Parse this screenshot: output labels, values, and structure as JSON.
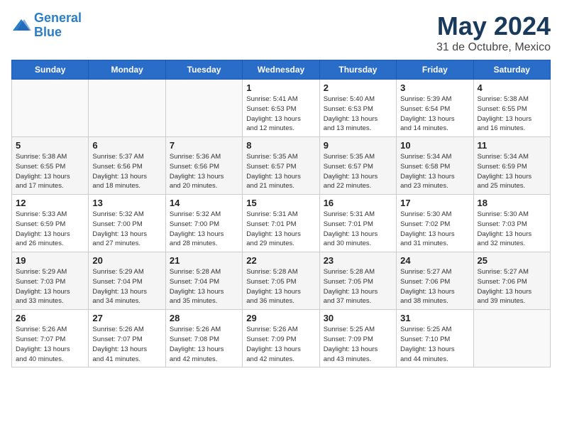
{
  "logo": {
    "line1": "General",
    "line2": "Blue"
  },
  "title": "May 2024",
  "subtitle": "31 de Octubre, Mexico",
  "days_header": [
    "Sunday",
    "Monday",
    "Tuesday",
    "Wednesday",
    "Thursday",
    "Friday",
    "Saturday"
  ],
  "weeks": [
    [
      {
        "num": "",
        "info": ""
      },
      {
        "num": "",
        "info": ""
      },
      {
        "num": "",
        "info": ""
      },
      {
        "num": "1",
        "info": "Sunrise: 5:41 AM\nSunset: 6:53 PM\nDaylight: 13 hours\nand 12 minutes."
      },
      {
        "num": "2",
        "info": "Sunrise: 5:40 AM\nSunset: 6:53 PM\nDaylight: 13 hours\nand 13 minutes."
      },
      {
        "num": "3",
        "info": "Sunrise: 5:39 AM\nSunset: 6:54 PM\nDaylight: 13 hours\nand 14 minutes."
      },
      {
        "num": "4",
        "info": "Sunrise: 5:38 AM\nSunset: 6:55 PM\nDaylight: 13 hours\nand 16 minutes."
      }
    ],
    [
      {
        "num": "5",
        "info": "Sunrise: 5:38 AM\nSunset: 6:55 PM\nDaylight: 13 hours\nand 17 minutes."
      },
      {
        "num": "6",
        "info": "Sunrise: 5:37 AM\nSunset: 6:56 PM\nDaylight: 13 hours\nand 18 minutes."
      },
      {
        "num": "7",
        "info": "Sunrise: 5:36 AM\nSunset: 6:56 PM\nDaylight: 13 hours\nand 20 minutes."
      },
      {
        "num": "8",
        "info": "Sunrise: 5:35 AM\nSunset: 6:57 PM\nDaylight: 13 hours\nand 21 minutes."
      },
      {
        "num": "9",
        "info": "Sunrise: 5:35 AM\nSunset: 6:57 PM\nDaylight: 13 hours\nand 22 minutes."
      },
      {
        "num": "10",
        "info": "Sunrise: 5:34 AM\nSunset: 6:58 PM\nDaylight: 13 hours\nand 23 minutes."
      },
      {
        "num": "11",
        "info": "Sunrise: 5:34 AM\nSunset: 6:59 PM\nDaylight: 13 hours\nand 25 minutes."
      }
    ],
    [
      {
        "num": "12",
        "info": "Sunrise: 5:33 AM\nSunset: 6:59 PM\nDaylight: 13 hours\nand 26 minutes."
      },
      {
        "num": "13",
        "info": "Sunrise: 5:32 AM\nSunset: 7:00 PM\nDaylight: 13 hours\nand 27 minutes."
      },
      {
        "num": "14",
        "info": "Sunrise: 5:32 AM\nSunset: 7:00 PM\nDaylight: 13 hours\nand 28 minutes."
      },
      {
        "num": "15",
        "info": "Sunrise: 5:31 AM\nSunset: 7:01 PM\nDaylight: 13 hours\nand 29 minutes."
      },
      {
        "num": "16",
        "info": "Sunrise: 5:31 AM\nSunset: 7:01 PM\nDaylight: 13 hours\nand 30 minutes."
      },
      {
        "num": "17",
        "info": "Sunrise: 5:30 AM\nSunset: 7:02 PM\nDaylight: 13 hours\nand 31 minutes."
      },
      {
        "num": "18",
        "info": "Sunrise: 5:30 AM\nSunset: 7:03 PM\nDaylight: 13 hours\nand 32 minutes."
      }
    ],
    [
      {
        "num": "19",
        "info": "Sunrise: 5:29 AM\nSunset: 7:03 PM\nDaylight: 13 hours\nand 33 minutes."
      },
      {
        "num": "20",
        "info": "Sunrise: 5:29 AM\nSunset: 7:04 PM\nDaylight: 13 hours\nand 34 minutes."
      },
      {
        "num": "21",
        "info": "Sunrise: 5:28 AM\nSunset: 7:04 PM\nDaylight: 13 hours\nand 35 minutes."
      },
      {
        "num": "22",
        "info": "Sunrise: 5:28 AM\nSunset: 7:05 PM\nDaylight: 13 hours\nand 36 minutes."
      },
      {
        "num": "23",
        "info": "Sunrise: 5:28 AM\nSunset: 7:05 PM\nDaylight: 13 hours\nand 37 minutes."
      },
      {
        "num": "24",
        "info": "Sunrise: 5:27 AM\nSunset: 7:06 PM\nDaylight: 13 hours\nand 38 minutes."
      },
      {
        "num": "25",
        "info": "Sunrise: 5:27 AM\nSunset: 7:06 PM\nDaylight: 13 hours\nand 39 minutes."
      }
    ],
    [
      {
        "num": "26",
        "info": "Sunrise: 5:26 AM\nSunset: 7:07 PM\nDaylight: 13 hours\nand 40 minutes."
      },
      {
        "num": "27",
        "info": "Sunrise: 5:26 AM\nSunset: 7:07 PM\nDaylight: 13 hours\nand 41 minutes."
      },
      {
        "num": "28",
        "info": "Sunrise: 5:26 AM\nSunset: 7:08 PM\nDaylight: 13 hours\nand 42 minutes."
      },
      {
        "num": "29",
        "info": "Sunrise: 5:26 AM\nSunset: 7:09 PM\nDaylight: 13 hours\nand 42 minutes."
      },
      {
        "num": "30",
        "info": "Sunrise: 5:25 AM\nSunset: 7:09 PM\nDaylight: 13 hours\nand 43 minutes."
      },
      {
        "num": "31",
        "info": "Sunrise: 5:25 AM\nSunset: 7:10 PM\nDaylight: 13 hours\nand 44 minutes."
      },
      {
        "num": "",
        "info": ""
      }
    ]
  ]
}
